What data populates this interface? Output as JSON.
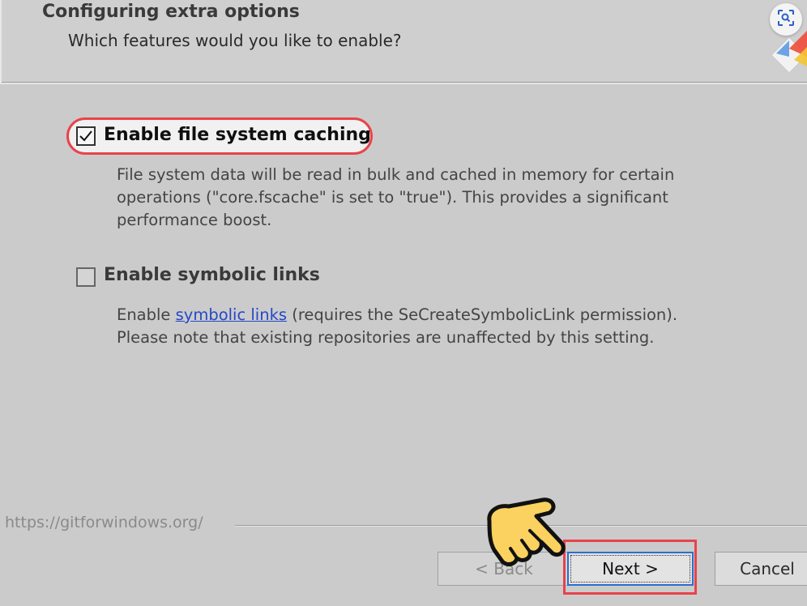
{
  "header": {
    "title": "Configuring extra options",
    "subtitle": "Which features would you like to enable?"
  },
  "options": [
    {
      "label": "Enable file system caching",
      "checked": true,
      "description_lines": [
        "File system data will be read in bulk and cached in memory for certain",
        "operations (\"core.fscache\" is set to \"true\"). This provides a significant",
        "performance boost."
      ]
    },
    {
      "label": "Enable symbolic links",
      "checked": false,
      "description": {
        "prefix": "Enable ",
        "link_text": "symbolic links",
        "suffix": " (requires the SeCreateSymbolicLink permission).",
        "line2": "Please note that existing repositories are unaffected by this setting."
      }
    }
  ],
  "footer": {
    "url": "https://gitforwindows.org/",
    "back_label": "< Back",
    "next_label": "Next >",
    "cancel_label": "Cancel"
  },
  "icons": {
    "lens": "lens-search-icon",
    "hand": "pointing-hand-icon",
    "check": "checkmark-icon"
  },
  "colors": {
    "highlight": "#e8434a",
    "link": "#2448c8",
    "focus": "#2a6fd0",
    "hand": "#fbd160"
  }
}
